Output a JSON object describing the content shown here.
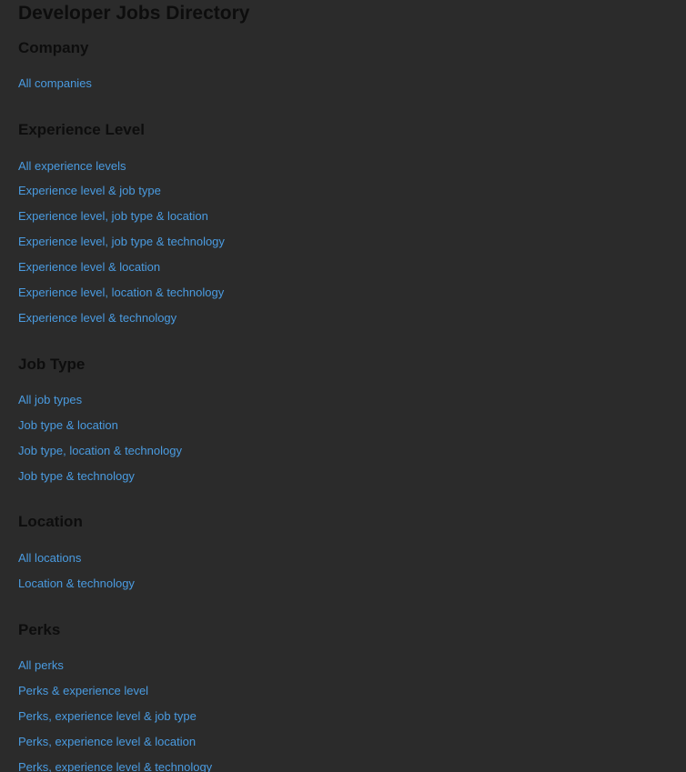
{
  "title": "Developer Jobs Directory",
  "sections": [
    {
      "heading": "Company",
      "links": [
        "All companies"
      ]
    },
    {
      "heading": "Experience Level",
      "links": [
        "All experience levels",
        "Experience level & job type",
        "Experience level, job type & location",
        "Experience level, job type & technology",
        "Experience level & location",
        "Experience level, location & technology",
        "Experience level & technology"
      ]
    },
    {
      "heading": "Job Type",
      "links": [
        "All job types",
        "Job type & location",
        "Job type, location & technology",
        "Job type & technology"
      ]
    },
    {
      "heading": "Location",
      "links": [
        "All locations",
        "Location & technology"
      ]
    },
    {
      "heading": "Perks",
      "links": [
        "All perks",
        "Perks & experience level",
        "Perks, experience level & job type",
        "Perks, experience level & location",
        "Perks, experience level & technology"
      ]
    }
  ],
  "colors": {
    "background": "#2b2b2b",
    "heading": "#0d0d0d",
    "link": "#4a9be0"
  }
}
